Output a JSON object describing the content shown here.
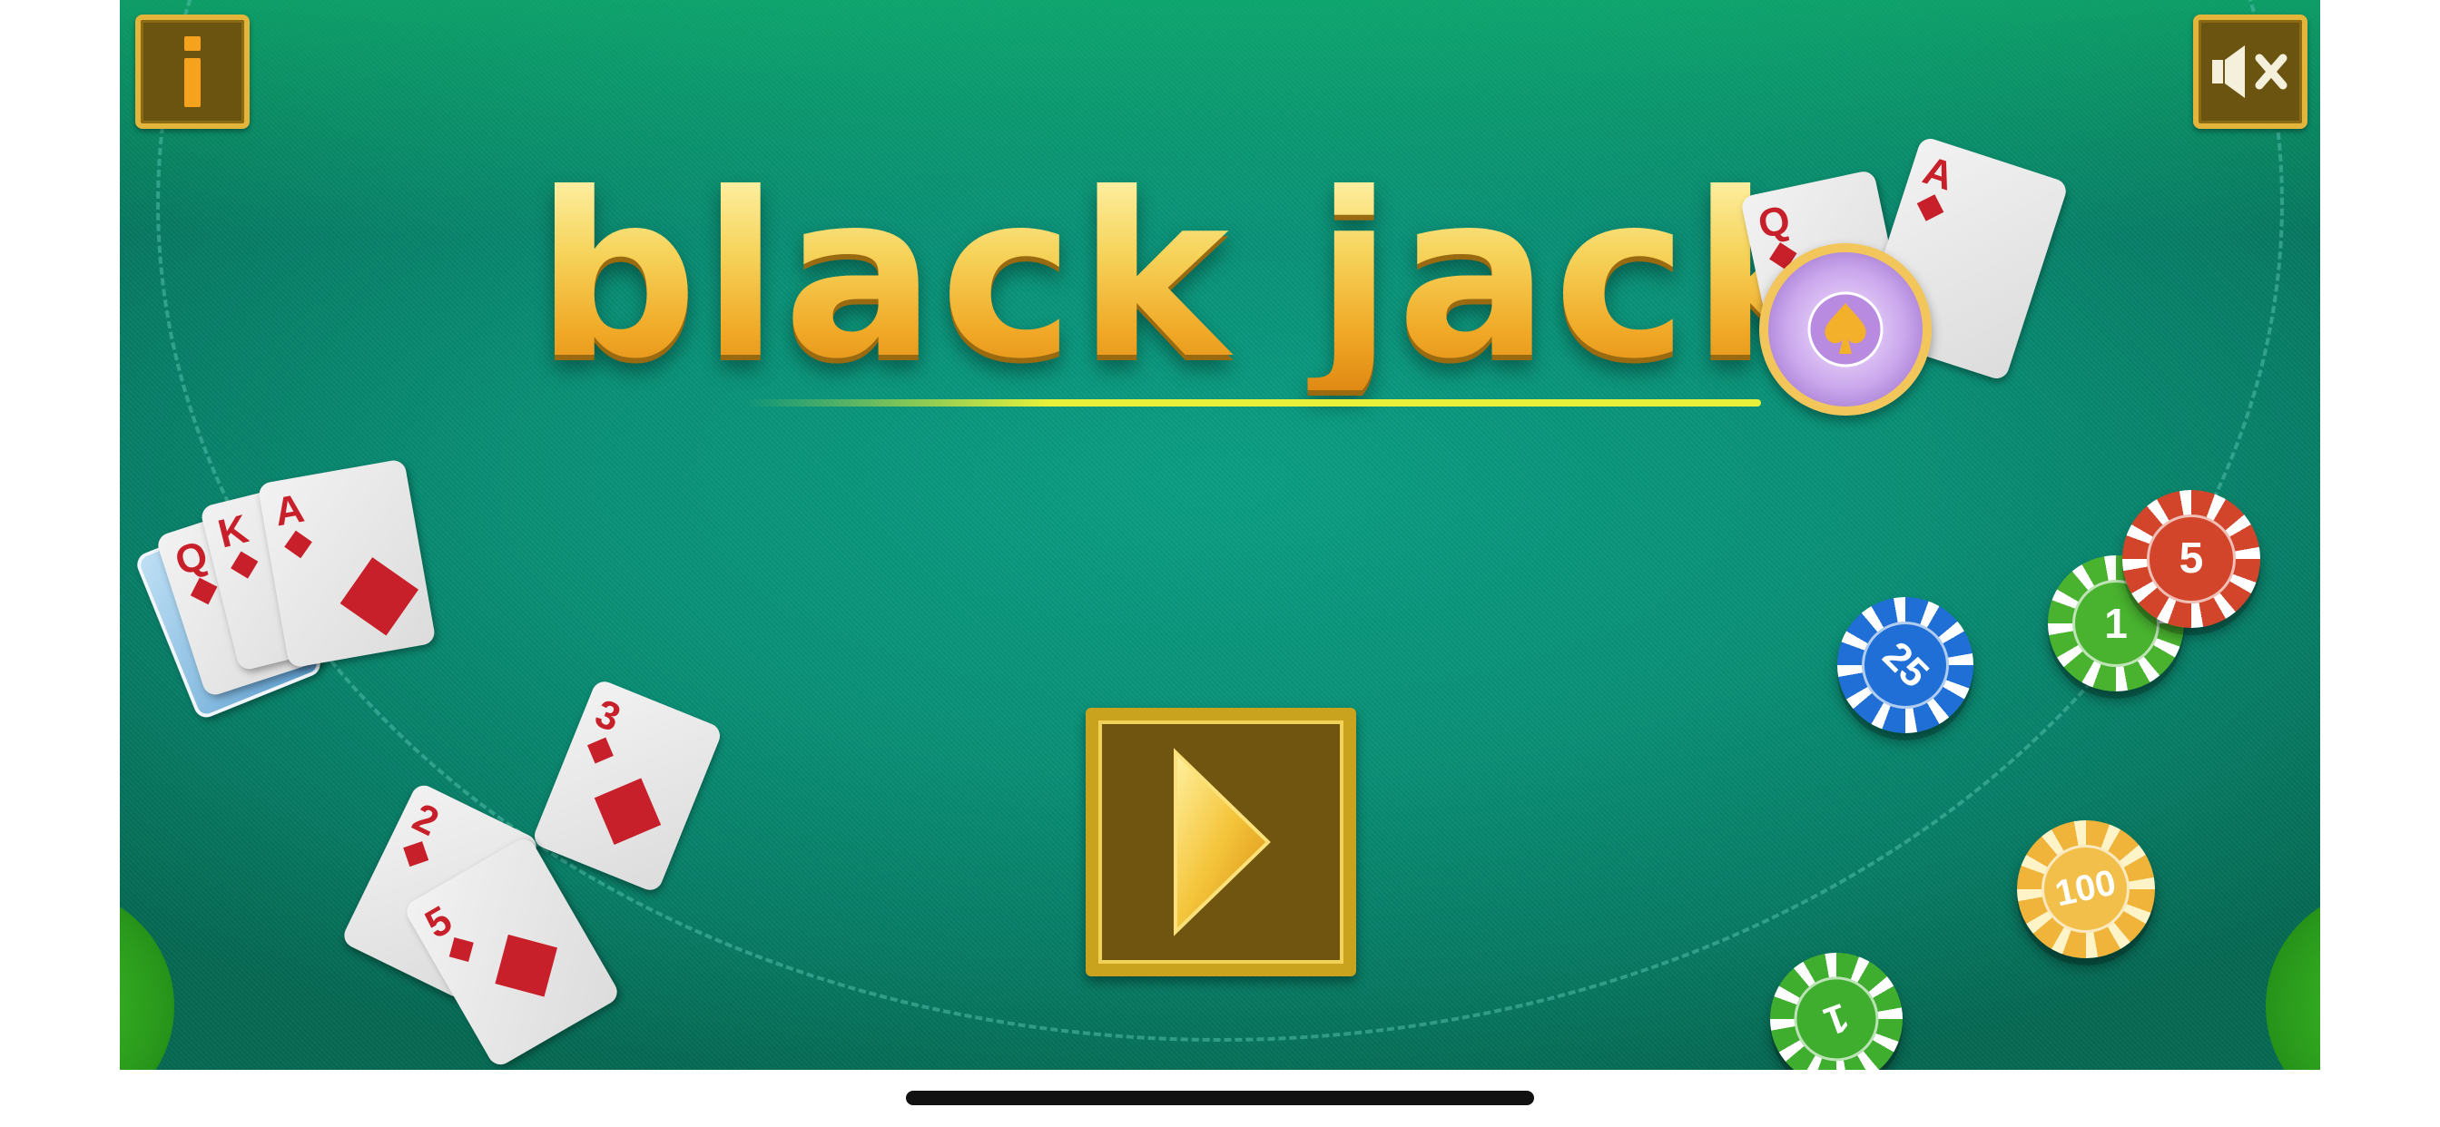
{
  "game": {
    "title": "black jack",
    "info_icon_glyph": "i",
    "info_icon": "info-icon",
    "mute_icon": "speaker-muted-icon",
    "play_icon": "play-icon"
  },
  "decor": {
    "logo_cards": [
      {
        "rank": "Q"
      },
      {
        "rank": "A"
      }
    ],
    "hand_cards_top": [
      {
        "rank": "Q"
      },
      {
        "rank": "K"
      },
      {
        "rank": "A"
      }
    ],
    "loose_cards": [
      {
        "rank": "3"
      },
      {
        "rank": "2"
      },
      {
        "rank": "5"
      }
    ],
    "chips": [
      {
        "value": "25",
        "color": "#1f6fd6"
      },
      {
        "value": "5",
        "color": "#d2452a"
      },
      {
        "value": "1",
        "color": "#49b32f"
      },
      {
        "value": "100",
        "color": "#f0b43a"
      },
      {
        "value": "1",
        "color": "#3fae2e"
      }
    ]
  },
  "colors": {
    "felt": "#0a8f76",
    "gold": "#e3b53a",
    "button_bg": "#6b5410"
  }
}
